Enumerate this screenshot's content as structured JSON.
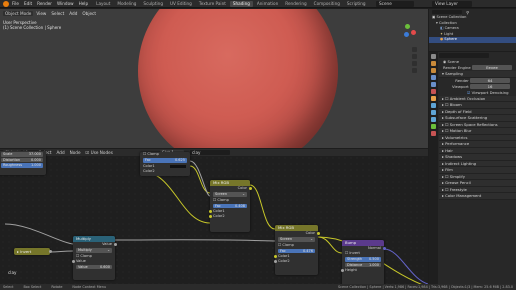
{
  "topbar": {
    "menus": [
      "File",
      "Edit",
      "Render",
      "Window",
      "Help"
    ],
    "workspaces": [
      "Layout",
      "Modeling",
      "Sculpting",
      "UV Editing",
      "Texture Paint",
      "Shading",
      "Animation",
      "Rendering",
      "Compositing",
      "Scripting"
    ],
    "active_workspace": "Shading",
    "scene_label": "Scene",
    "view_layer_label": "View Layer"
  },
  "viewport": {
    "mode": "Object Mode",
    "menus": [
      "View",
      "Select",
      "Add",
      "Object"
    ],
    "info_title": "User Perspective",
    "info_sub": "(1) Scene Collection | Sphere",
    "gizmo_x": "X",
    "gizmo_y": "Y",
    "gizmo_z": "Z"
  },
  "node_editor": {
    "type": "Object",
    "menus": [
      "View",
      "Select",
      "Add",
      "Node"
    ],
    "use_nodes": "Use Nodes",
    "slot": "Slot 1",
    "material": "clay"
  },
  "nodes": {
    "mapping": {
      "rows": [
        {
          "label": "Scale",
          "value": "37.000"
        },
        {
          "label": "Distortion",
          "value": "0.000"
        },
        {
          "label": "Roughness",
          "value": "1.000"
        }
      ]
    },
    "clamp_top": {
      "clamp": "Clamp",
      "fac_label": "Fac",
      "fac_value": "0.625",
      "color1": "Color1",
      "color2": "Color2"
    },
    "mix1": {
      "title": "Mix RGB",
      "out": "Color",
      "blend": "Screen",
      "clamp": "Clamp",
      "fac_label": "Fac",
      "fac_value": "0.408",
      "color1": "Color1",
      "color2": "Color2"
    },
    "mix2": {
      "title": "Mix RGB",
      "out": "Color",
      "blend": "Screen",
      "clamp": "Clamp",
      "fac_label": "Fac",
      "fac_value": "0.476",
      "color1": "Color1",
      "color2": "Color2"
    },
    "multiply": {
      "title": "Multiply",
      "out": "Value",
      "op": "Multiply",
      "clamp": "Clamp",
      "value_label": "Value",
      "value_label2": "Value",
      "value2": "0.600"
    },
    "invert": {
      "title": "Invert"
    },
    "bump": {
      "title": "Bump",
      "out": "Normal",
      "invert": "Invert",
      "strength_label": "Strength",
      "strength": "0.500",
      "distance_label": "Distance",
      "distance": "1.000",
      "height": "Height"
    },
    "clay_label": "clay"
  },
  "outliner": {
    "rows": [
      "Scene Collection",
      "Collection",
      "Camera",
      "Light",
      "Sphere"
    ]
  },
  "properties": {
    "scene_name": "Scene",
    "render_engine_label": "Render Engine",
    "render_engine": "Eevee",
    "sampling": "Sampling",
    "render_label": "Render",
    "render_value": "64",
    "viewport_label": "Viewport",
    "viewport_value": "16",
    "viewport_denoising": "Viewport Denoising",
    "panels": [
      "Ambient Occlusion",
      "Bloom",
      "Depth of Field",
      "Subsurface Scattering",
      "Screen Space Reflections",
      "Motion Blur",
      "Volumetrics",
      "Performance",
      "Hair",
      "Shadows",
      "Indirect Lighting",
      "Film",
      "Simplify",
      "Grease Pencil",
      "Freestyle",
      "Color Management"
    ]
  },
  "statusbar": {
    "select": "Select",
    "box_select": "Box Select",
    "rotate": "Rotate",
    "context_menu": "Node Context Menu",
    "stats": "Scene Collection | Sphere | Verts:1,986 | Faces:1,984 | Tris:3,968 | Objects:1/3 | Mem: 25.6 MiB | 2.83.0"
  },
  "colors": {
    "accent": "#e87d0d",
    "selection": "#334d80",
    "mix_header": "#76762a",
    "math_header": "#2a6278",
    "bump_header": "#5b3a8c"
  },
  "icons": [
    "blender-logo-icon",
    "filter-icon",
    "camera-icon",
    "light-icon",
    "sphere-icon",
    "scene-icon",
    "render-icon",
    "output-icon",
    "world-icon",
    "material-icon"
  ]
}
